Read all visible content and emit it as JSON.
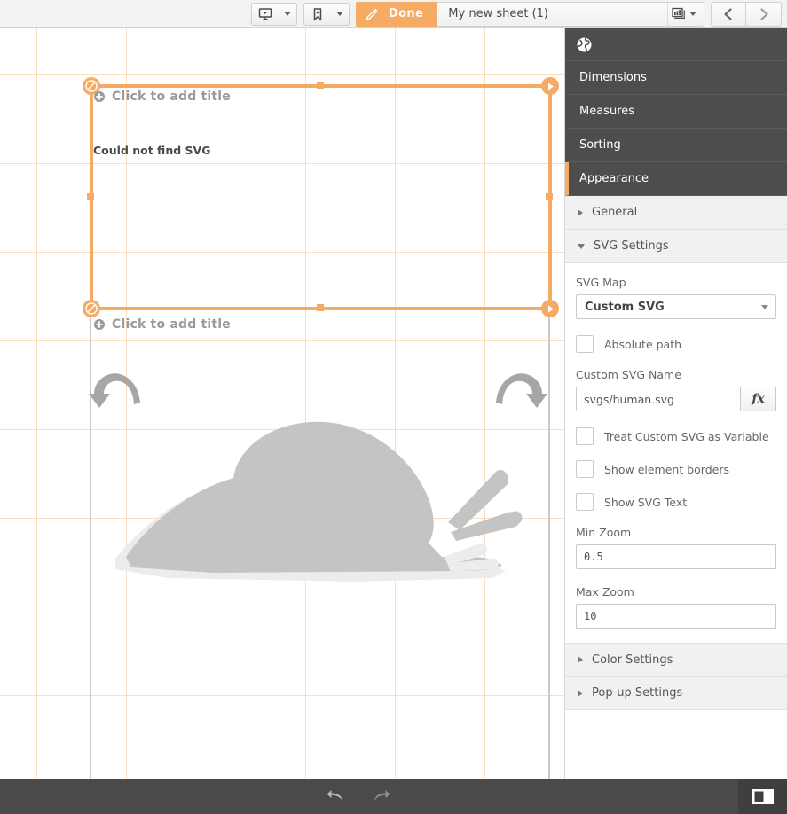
{
  "topbar": {
    "present_icon": "presentation-icon",
    "bookmark_icon": "bookmark-icon",
    "done_label": "Done",
    "edit_icon": "pencil-icon",
    "sheet_name": "My new sheet (1)",
    "sheet_select_icon": "chart-select-icon",
    "prev_icon": "chevron-left-icon",
    "next_icon": "chevron-right-icon"
  },
  "canvas": {
    "title_top_placeholder": "Click to add title",
    "title_bottom_placeholder": "Click to add title",
    "error_text": "Could not find SVG",
    "add_title_icon": "plus-circle-icon",
    "handle_block_icon": "no-entry-icon",
    "handle_play_icon": "triangle-right-icon",
    "rotate_left_icon": "rotate-left-icon",
    "rotate_right_icon": "rotate-right-icon",
    "graphic": "snail-silhouette",
    "grid_color": "#f5ab63",
    "accent_color": "#f5ab63"
  },
  "panel": {
    "header_icon": "globe-icon",
    "tabs": [
      {
        "label": "Dimensions",
        "active": false
      },
      {
        "label": "Measures",
        "active": false
      },
      {
        "label": "Sorting",
        "active": false
      },
      {
        "label": "Appearance",
        "active": true
      }
    ],
    "sections": [
      {
        "label": "General",
        "expanded": false
      },
      {
        "label": "SVG Settings",
        "expanded": true
      },
      {
        "label": "Color Settings",
        "expanded": false
      },
      {
        "label": "Pop-up Settings",
        "expanded": false
      }
    ],
    "svg_settings": {
      "svg_map_label": "SVG Map",
      "svg_map_value": "Custom SVG",
      "absolute_path_label": "Absolute path",
      "absolute_path_checked": false,
      "custom_svg_name_label": "Custom SVG Name",
      "custom_svg_name_value": "svgs/human.svg",
      "fx_label": "fx",
      "treat_variable_label": "Treat Custom SVG as Variable",
      "treat_variable_checked": false,
      "element_borders_label": "Show element borders",
      "element_borders_checked": false,
      "svg_text_label": "Show SVG Text",
      "svg_text_checked": false,
      "min_zoom_label": "Min Zoom",
      "min_zoom_value": "0.5",
      "max_zoom_label": "Max Zoom",
      "max_zoom_value": "10"
    }
  },
  "bottombar": {
    "undo_icon": "undo-arrow-icon",
    "redo_icon": "redo-arrow-icon",
    "toggle_panel_icon": "toggle-panel-icon"
  }
}
